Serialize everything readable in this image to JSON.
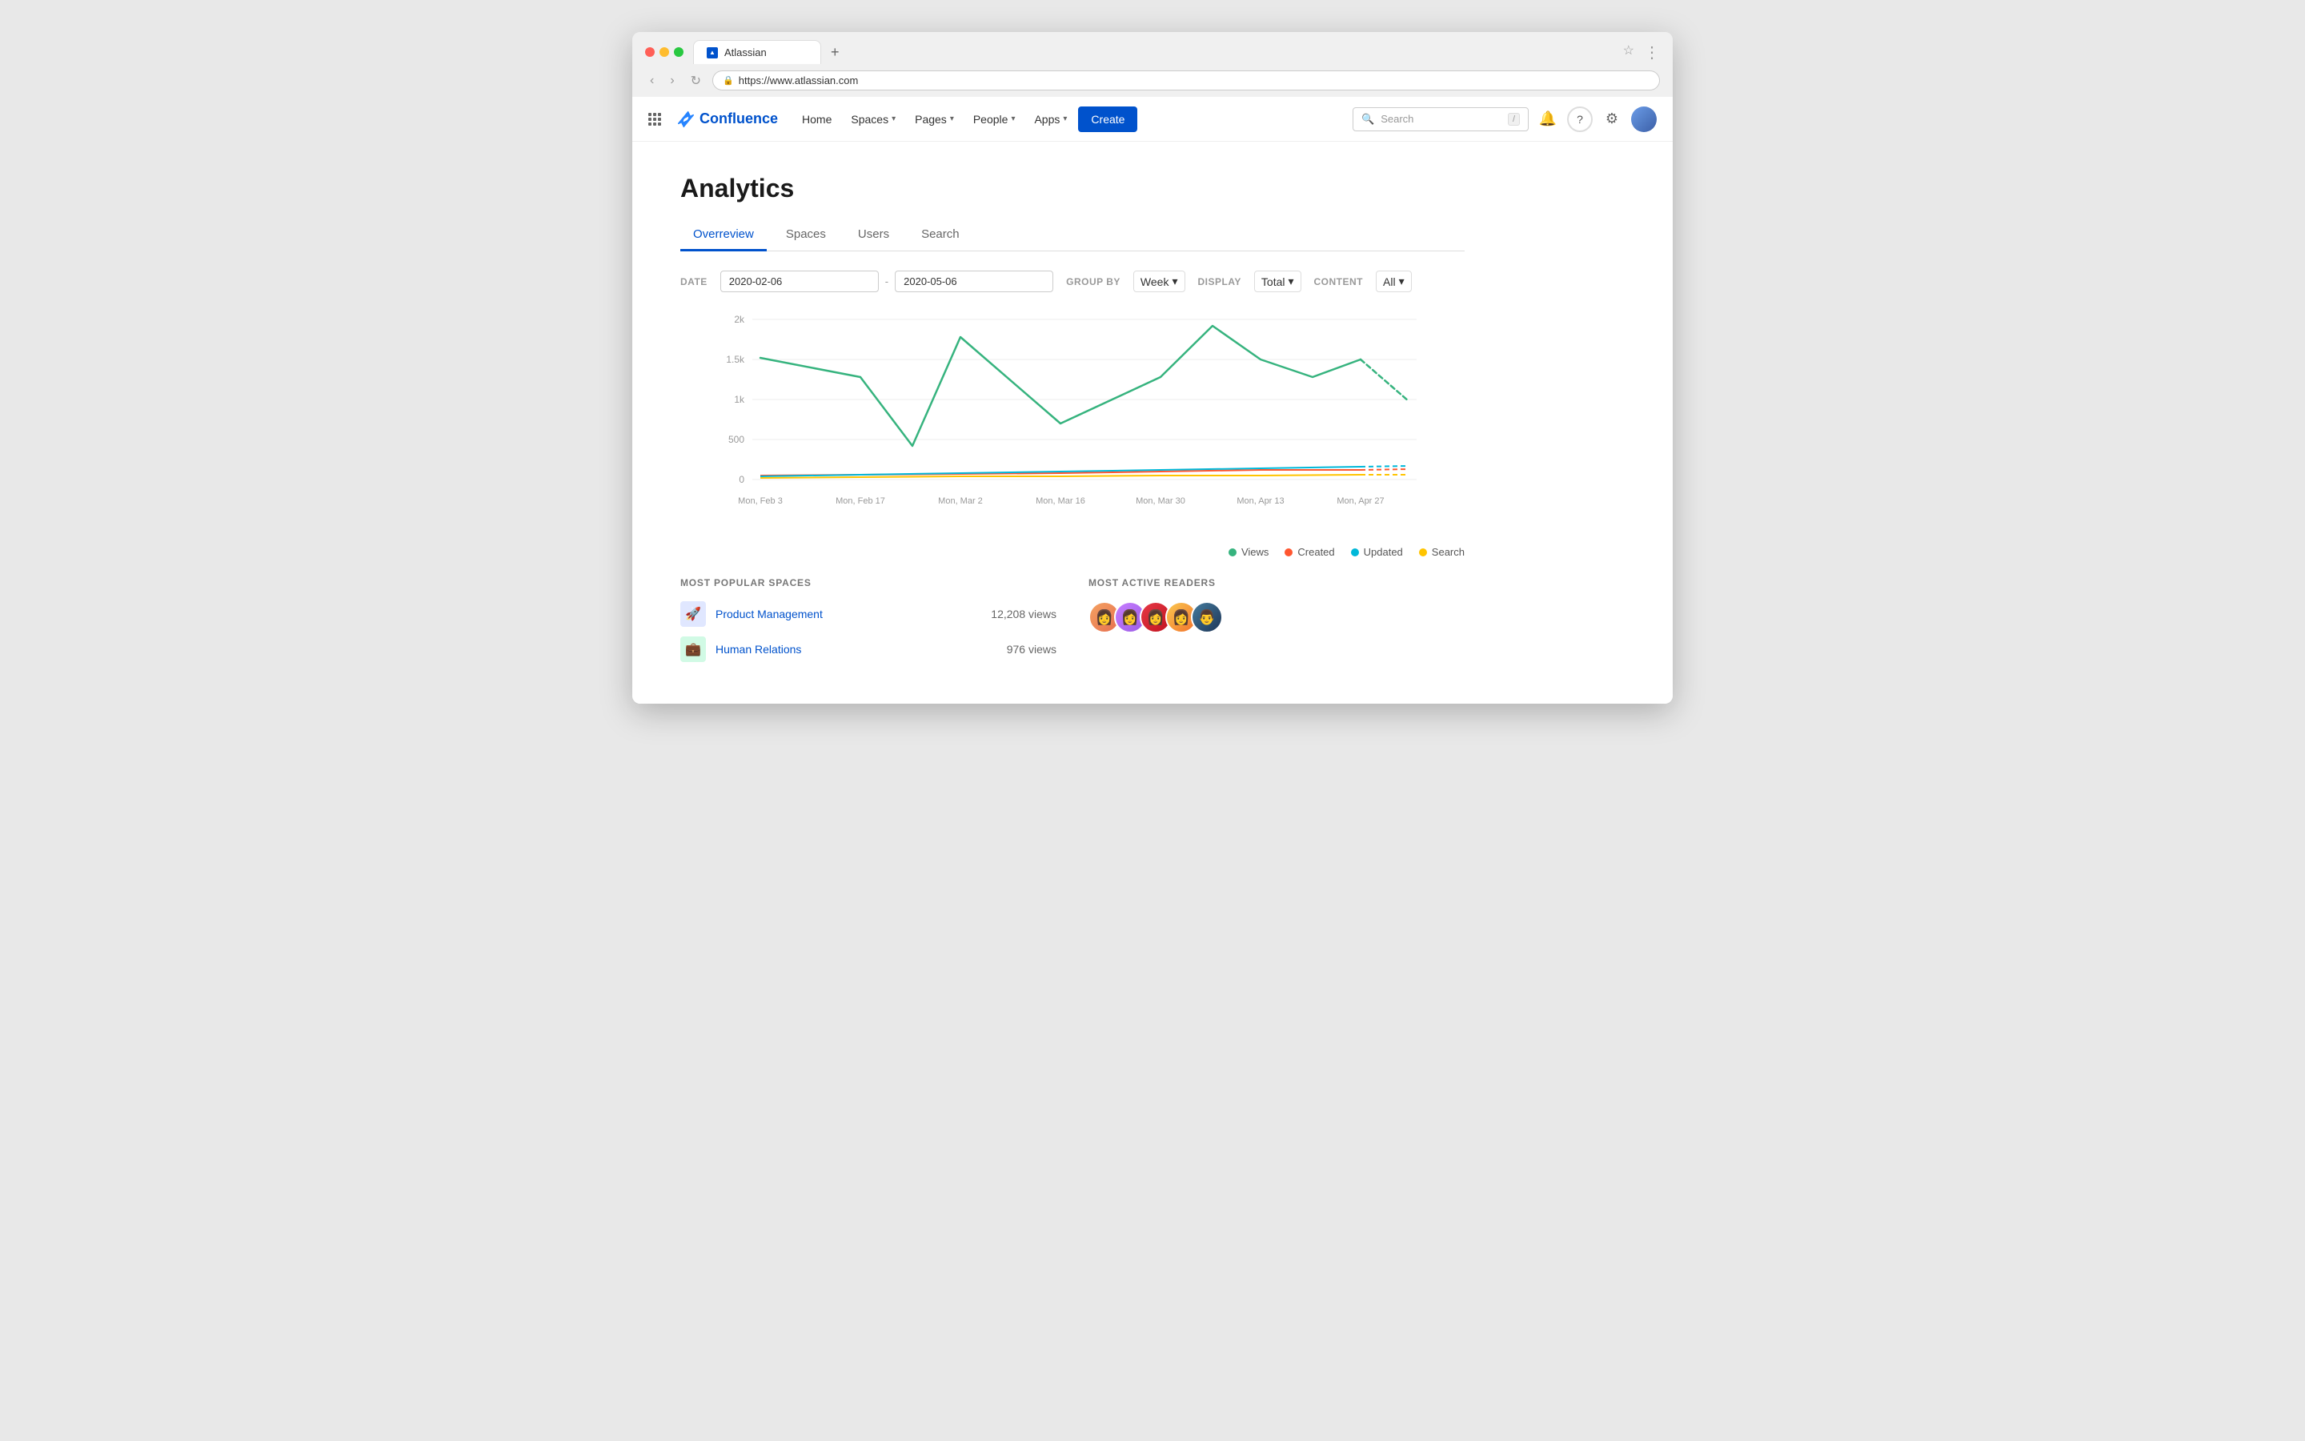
{
  "browser": {
    "url": "https://www.atlassian.com",
    "tab_title": "Atlassian",
    "tab_favicon": "▲"
  },
  "nav": {
    "app_name": "Confluence",
    "home": "Home",
    "spaces": "Spaces",
    "pages": "Pages",
    "people": "People",
    "apps": "Apps",
    "create": "Create",
    "search_placeholder": "Search",
    "search_shortcut": "/",
    "notifications_icon": "bell",
    "help_icon": "question",
    "settings_icon": "gear",
    "user_icon": "user-avatar"
  },
  "page": {
    "title": "Analytics",
    "tabs": [
      {
        "id": "overview",
        "label": "Overreview",
        "active": true
      },
      {
        "id": "spaces",
        "label": "Spaces",
        "active": false
      },
      {
        "id": "users",
        "label": "Users",
        "active": false
      },
      {
        "id": "search",
        "label": "Search",
        "active": false
      }
    ]
  },
  "filters": {
    "date_label": "DATE",
    "date_from": "2020-02-06",
    "date_to": "2020-05-06",
    "group_by_label": "GROUP BY",
    "group_by_value": "Week",
    "display_label": "DISPLAY",
    "display_value": "Total",
    "content_label": "CONTENT",
    "content_value": "All"
  },
  "chart": {
    "y_labels": [
      "2k",
      "1.5k",
      "1k",
      "500",
      "0"
    ],
    "x_labels": [
      "Mon, Feb 3",
      "Mon, Feb 17",
      "Mon, Mar 2",
      "Mon, Mar 16",
      "Mon, Mar 30",
      "Mon, Apr 13",
      "Mon, Apr 27"
    ],
    "legend": [
      {
        "id": "views",
        "label": "Views",
        "color": "#36b37e"
      },
      {
        "id": "created",
        "label": "Created",
        "color": "#ff5630"
      },
      {
        "id": "updated",
        "label": "Updated",
        "color": "#00b8d9"
      },
      {
        "id": "search",
        "label": "Search",
        "color": "#ffc400"
      }
    ]
  },
  "most_popular_spaces": {
    "section_title": "MOST POPULAR SPACES",
    "items": [
      {
        "name": "Product Management",
        "views": "12,208 views",
        "icon": "🚀",
        "icon_class": "blue"
      },
      {
        "name": "Human Relations",
        "views": "976 views",
        "icon": "💼",
        "icon_class": "teal"
      }
    ]
  },
  "most_active_readers": {
    "section_title": "MOST ACTIVE READERS",
    "readers": [
      {
        "id": 1,
        "face": "👩"
      },
      {
        "id": 2,
        "face": "👩"
      },
      {
        "id": 3,
        "face": "👩"
      },
      {
        "id": 4,
        "face": "👩"
      },
      {
        "id": 5,
        "face": "👨"
      }
    ]
  }
}
